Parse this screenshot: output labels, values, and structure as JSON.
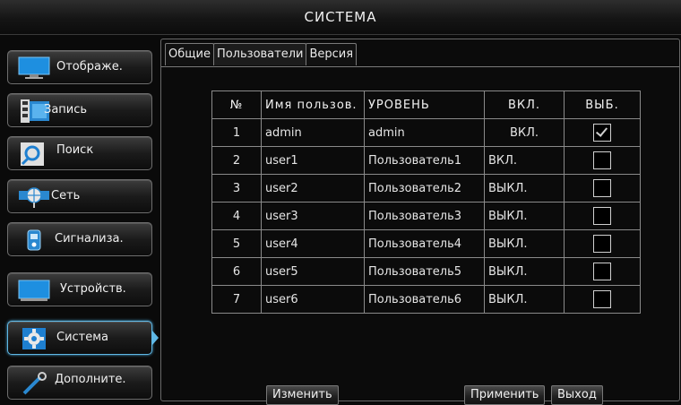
{
  "window": {
    "title": "СИСТЕМА"
  },
  "sidebar": {
    "items": [
      {
        "label": "Отображе.",
        "icon": "monitor-icon"
      },
      {
        "label": "Запись",
        "icon": "film-icon"
      },
      {
        "label": "Поиск",
        "icon": "search-icon"
      },
      {
        "label": "Сеть",
        "icon": "globe-network-icon"
      },
      {
        "label": "Сигнализа.",
        "icon": "alarm-icon"
      },
      {
        "label": "Устройств.",
        "icon": "device-icon"
      },
      {
        "label": "Система",
        "icon": "gear-icon",
        "active": true
      },
      {
        "label": "Дополните.",
        "icon": "wrench-icon"
      }
    ]
  },
  "tabs": [
    "Общие",
    "Пользователи",
    "Версия"
  ],
  "active_tab": "Пользователи",
  "table": {
    "headers": {
      "no": "№",
      "name": "Имя пользов.",
      "level": "УРОВЕНЬ",
      "enabled": "ВКЛ.",
      "select": "ВЫБ."
    },
    "rows": [
      {
        "no": "1",
        "name": "admin",
        "level": "admin",
        "enabled": "ВКЛ.",
        "selected": true
      },
      {
        "no": "2",
        "name": "user1",
        "level": "Пользователь1",
        "enabled": "ВКЛ.",
        "selected": false
      },
      {
        "no": "3",
        "name": "user2",
        "level": "Пользователь2",
        "enabled": "ВЫКЛ.",
        "selected": false
      },
      {
        "no": "4",
        "name": "user3",
        "level": "Пользователь3",
        "enabled": "ВЫКЛ.",
        "selected": false
      },
      {
        "no": "5",
        "name": "user4",
        "level": "Пользователь4",
        "enabled": "ВЫКЛ.",
        "selected": false
      },
      {
        "no": "6",
        "name": "user5",
        "level": "Пользователь5",
        "enabled": "ВЫКЛ.",
        "selected": false
      },
      {
        "no": "7",
        "name": "user6",
        "level": "Пользователь6",
        "enabled": "ВЫКЛ.",
        "selected": false
      }
    ]
  },
  "buttons": {
    "edit": "Изменить",
    "apply": "Применить",
    "exit": "Выход"
  },
  "colors": {
    "accent": "#2f8fd8",
    "active_border": "#5fb8e6"
  }
}
